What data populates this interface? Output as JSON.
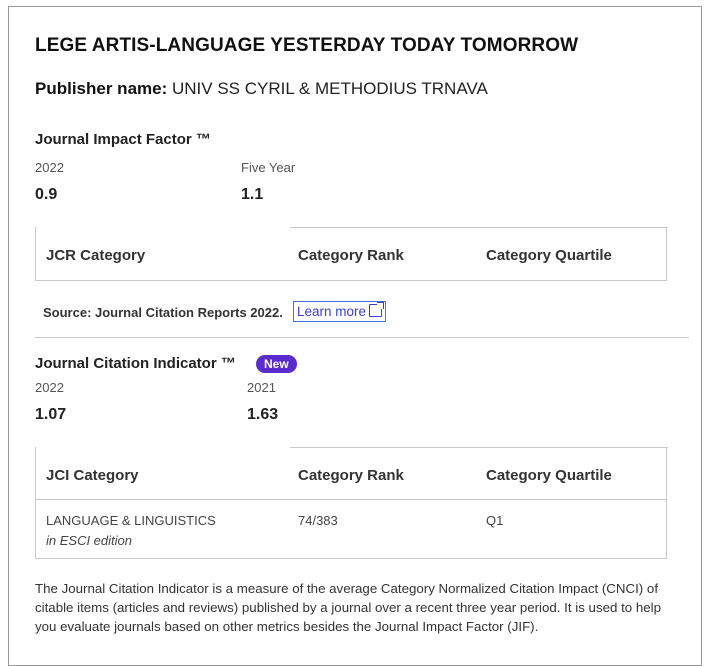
{
  "journal_title": "LEGE ARTIS-LANGUAGE YESTERDAY TODAY TOMORROW",
  "publisher": {
    "label": "Publisher name:",
    "value": "UNIV SS CYRIL & METHODIUS TRNAVA"
  },
  "jif": {
    "heading": "Journal Impact Factor ™",
    "col1_label": "2022",
    "col1_value": "0.9",
    "col2_label": "Five Year",
    "col2_value": "1.1",
    "table_headers": [
      "JCR Category",
      "Category Rank",
      "Category Quartile"
    ]
  },
  "source": {
    "text": "Source: Journal Citation Reports 2022.",
    "link_label": "Learn more"
  },
  "jci": {
    "heading": "Journal Citation Indicator ™",
    "badge": "New",
    "col1_label": "2022",
    "col1_value": "1.07",
    "col2_label": "2021",
    "col2_value": "1.63",
    "table_headers": [
      "JCI Category",
      "Category Rank",
      "Category Quartile"
    ],
    "rows": [
      {
        "category": "LANGUAGE & LINGUISTICS",
        "edition": "in ESCI edition",
        "rank": "74/383",
        "quartile": "Q1"
      }
    ]
  },
  "description": "The Journal Citation Indicator is a measure of the average Category Normalized Citation Impact (CNCI) of citable items (articles and reviews) published by a journal over a recent three year period. It is used to help you evaluate journals based on other metrics besides the Journal Impact Factor (JIF).",
  "colors": {
    "badge": "#5b2bd0",
    "link": "#3b3fd8",
    "border": "#c9c9c9"
  }
}
